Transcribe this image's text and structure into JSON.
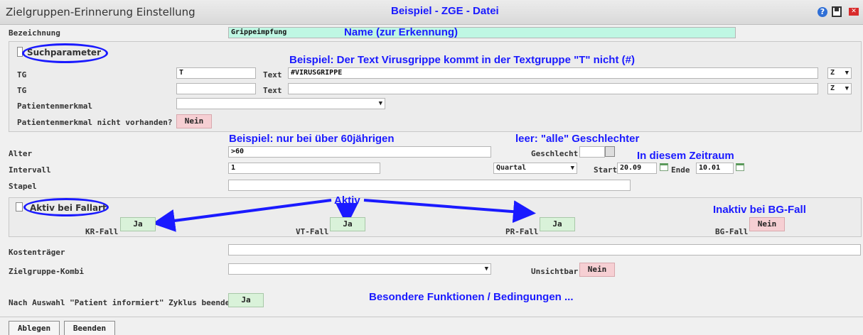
{
  "window": {
    "title": "Zielgruppen-Erinnerung Einstellung",
    "help_icon": "help-icon",
    "save_icon": "save-icon",
    "close_icon": "close-icon"
  },
  "annotations": {
    "header_example": "Beispiel - ZGE - Datei",
    "name_hint": "Name (zur Erkennung)",
    "search_hint": "Beispiel: Der Text Virusgrippe kommt in der Textgruppe \"T\" nicht (#)",
    "age_hint": "Beispiel: nur bei über 60jährigen",
    "gender_hint": "leer: \"alle\" Geschlechter",
    "period_hint": "In diesem Zeitraum",
    "active_hint": "Aktiv",
    "bg_hint": "Inaktiv bei BG-Fall",
    "special_hint": "Besondere Funktionen / Bedingungen ..."
  },
  "bezeichnung": {
    "label": "Bezeichnung",
    "value": "Grippeimpfung"
  },
  "suchparameter": {
    "header": "Suchparameter",
    "rows": [
      {
        "tg_label": "TG",
        "tg_value": "T",
        "text_label": "Text",
        "text_value": "#VIRUSGRIPPE",
        "z_value": "Z"
      },
      {
        "tg_label": "TG",
        "tg_value": "",
        "text_label": "Text",
        "text_value": "",
        "z_value": "Z"
      }
    ],
    "patientenmerkmal_label": "Patientenmerkmal",
    "patientenmerkmal_value": "",
    "nicht_vorhanden_label": "Patientenmerkmal nicht vorhanden?",
    "nicht_vorhanden_value": "Nein"
  },
  "alter": {
    "label": "Alter",
    "value": ">60"
  },
  "geschlecht": {
    "label": "Geschlecht",
    "value": ""
  },
  "intervall": {
    "label": "Intervall",
    "value": "1",
    "unit": "Quartal",
    "start_label": "Start",
    "start_value": "20.09",
    "ende_label": "Ende",
    "ende_value": "10.01"
  },
  "stapel": {
    "label": "Stapel",
    "value": ""
  },
  "fallart": {
    "header": "Aktiv bei Fallart",
    "items": [
      {
        "label": "KR-Fall",
        "value": "Ja"
      },
      {
        "label": "VT-Fall",
        "value": "Ja"
      },
      {
        "label": "PR-Fall",
        "value": "Ja"
      },
      {
        "label": "BG-Fall",
        "value": "Nein"
      }
    ]
  },
  "kostentraeger": {
    "label": "Kostenträger",
    "value": ""
  },
  "zielgruppe_kombi": {
    "label": "Zielgruppe-Kombi",
    "value": "",
    "unsichtbar_label": "Unsichtbar",
    "unsichtbar_value": "Nein"
  },
  "zyklus": {
    "label": "Nach Auswahl \"Patient informiert\" Zyklus beenden?",
    "value": "Ja"
  },
  "footer": {
    "ablegen": "Ablegen",
    "beenden": "Beenden"
  }
}
